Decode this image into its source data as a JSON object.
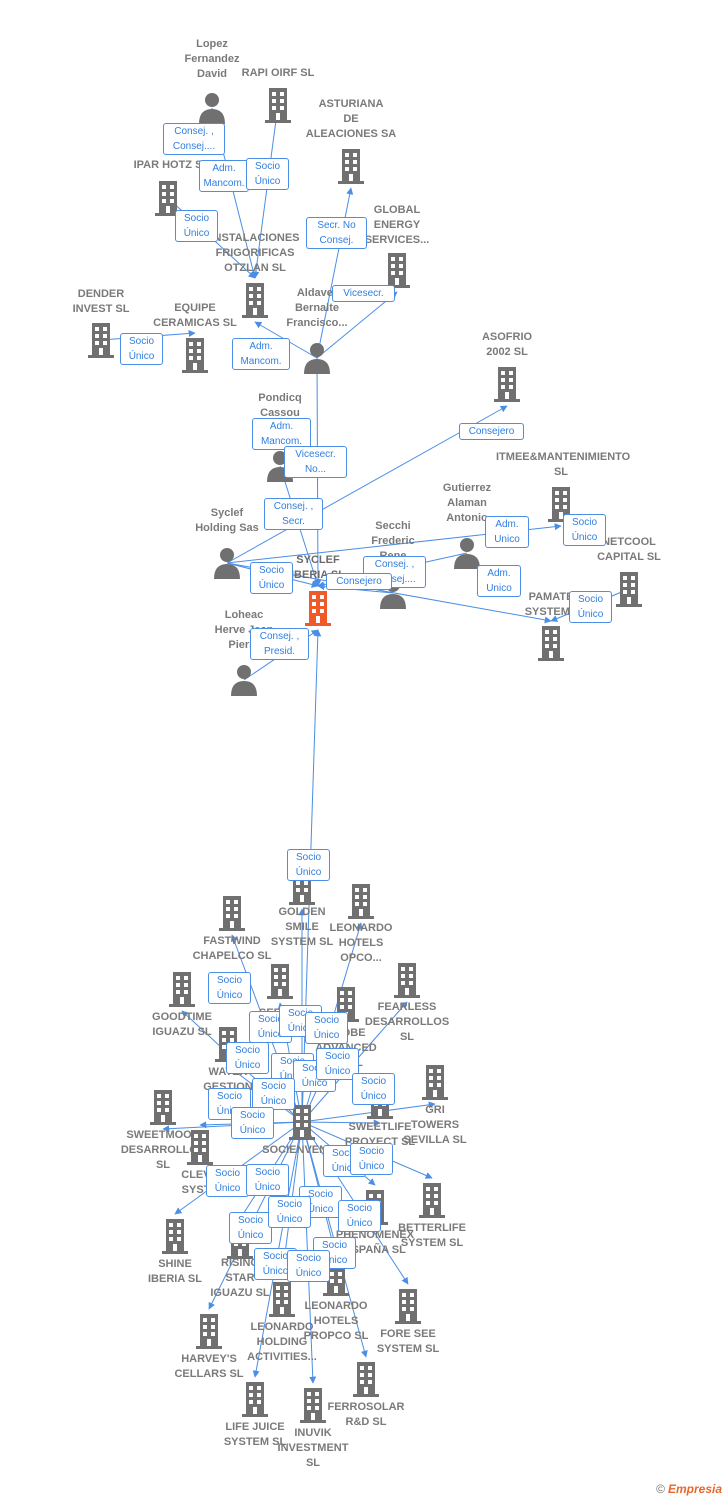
{
  "colors": {
    "edge": "#4a8ee6",
    "node_icon": "#707070",
    "main_node": "#f05a28",
    "label": "#7a7a7a"
  },
  "nodes": [
    {
      "label": "Lopez\nFernandez\nDavid",
      "type": "person"
    },
    {
      "label": "RAPI OIRF  SL",
      "type": "company"
    },
    {
      "label": "ASTURIANA\nDE\nALEACIONES SA",
      "type": "company"
    },
    {
      "label": "IPAR HOTZ S",
      "type": "company"
    },
    {
      "label": "INSTALACIONES\nFRIGORIFICAS\nOTZLAN SL",
      "type": "company"
    },
    {
      "label": "GLOBAL\nENERGY\nSERVICES...",
      "type": "company"
    },
    {
      "label": "DENDER\nINVEST  SL",
      "type": "company"
    },
    {
      "label": "EQUIPE\nCERAMICAS SL",
      "type": "company"
    },
    {
      "label": "Aldaver\nBernalte\nFrancisco...",
      "type": "person"
    },
    {
      "label": "ASOFRIO\n2002 SL",
      "type": "company"
    },
    {
      "label": "Pondicq\nCassou",
      "type": "person"
    },
    {
      "label": "ITMEE&MANTENIMIENTO\nSL",
      "type": "company"
    },
    {
      "label": "Gutierrez\nAlaman\nAntonio",
      "type": "person"
    },
    {
      "label": "Syclef\nHolding Sas",
      "type": "person"
    },
    {
      "label": "SYCLEF\nIBERIA  SL",
      "type": "main"
    },
    {
      "label": "Secchi\nFrederic\nRene",
      "type": "person"
    },
    {
      "label": "NETCOOL\nCAPITAL  SL",
      "type": "company"
    },
    {
      "label": "PAMATE\nSYSTEMS",
      "type": "company"
    },
    {
      "label": "Loheac\nHerve Jean\nPierre",
      "type": "person"
    },
    {
      "label": "GOLDEN\nSMILE\nSYSTEM  SL",
      "type": "company"
    },
    {
      "label": "LEONARDO\nHOTELS\nOPCO...",
      "type": "company"
    },
    {
      "label": "FASTWIND\nCHAPELCO  SL",
      "type": "company"
    },
    {
      "label": "GOODTIME\nIGUAZU  SL",
      "type": "company"
    },
    {
      "label": "SERVI...\nPU...",
      "type": "company"
    },
    {
      "label": "FEARLESS\nDESARROLLOS\nSL",
      "type": "company"
    },
    {
      "label": "GLOBE\nADVANCED\n...S  SL",
      "type": "company"
    },
    {
      "label": "WATER\nGESTION",
      "type": "company"
    },
    {
      "label": "GRI\nTOWERS\nSEVILLA  SL",
      "type": "company"
    },
    {
      "label": "SWEETMOON\nDESARROLLOS\nSL",
      "type": "company"
    },
    {
      "label": "SWEETLIFE\nPROYECT  SL",
      "type": "company"
    },
    {
      "label": "SOCIENVENT...",
      "type": "company"
    },
    {
      "label": "CLEV...\nSYST...",
      "type": "company"
    },
    {
      "label": "BETTERLIFE\nSYSTEM  SL",
      "type": "company"
    },
    {
      "label": "PHENOMENEX\nESPAÑA  SL",
      "type": "company"
    },
    {
      "label": "SHINE\nIBERIA  SL",
      "type": "company"
    },
    {
      "label": "RISING\nSTAR\nIGUAZU SL",
      "type": "company"
    },
    {
      "label": "LEONARDO\nHOLDING\nACTIVITIES...",
      "type": "company"
    },
    {
      "label": "LEONARDO\nHOTELS\nPROPCO  SL",
      "type": "company"
    },
    {
      "label": "FORE SEE\nSYSTEM  SL",
      "type": "company"
    },
    {
      "label": "HARVEY'S\nCELLARS  SL",
      "type": "company"
    },
    {
      "label": "FERROSOLAR\nR&D  SL",
      "type": "company"
    },
    {
      "label": "LIFE JUICE\nSYSTEM  SL",
      "type": "company"
    },
    {
      "label": "INUVIK\nINVESTMENT\nSL",
      "type": "company"
    }
  ],
  "edge_labels": [
    "Consej. ,\nConsej....",
    "Adm.\nMancom.",
    "Socio\nÚnico",
    "Socio\nÚnico",
    "Secr.  No\nConsej.",
    "Vicesecr.",
    "Socio\nÚnico",
    "Adm.\nMancom.",
    "Adm.\nMancom.",
    "Vicesecr.\nNo...",
    "Consej. ,\nSecr.",
    "Consejero",
    "Adm.\nUnico",
    "Socio\nÚnico",
    "Socio\nÚnico",
    "Consej. ,\nConsej....",
    "Consejero",
    "Adm.\nUnico",
    "Socio\nÚnico",
    "Consej. ,\nPresid.",
    "Socio\nÚnico",
    "Socio\nÚnico",
    "Socio\nÚnico",
    "Socio\nÚnico",
    "Socio\nÚnico",
    "Socio\nÚnico",
    "Socio\nÚnico",
    "Socio\nÚnico",
    "Socio\nÚnico",
    "Socio\nÚnico",
    "Socio\nÚnico",
    "Socio\nÚnico",
    "Socio\nÚnico",
    "Socio\nÚnico",
    "Socio\nÚnico",
    "Socio\nÚnico",
    "Socio\nÚnico",
    "Socio\nÚnico",
    "Socio\nÚnico",
    "Socio\nÚnico",
    "Socio\nÚnico",
    "Socio\nÚnico",
    "Socio\nÚnico",
    "Socio\nÚnico"
  ],
  "footer": {
    "copyright": "©",
    "brand": "Empresia"
  }
}
